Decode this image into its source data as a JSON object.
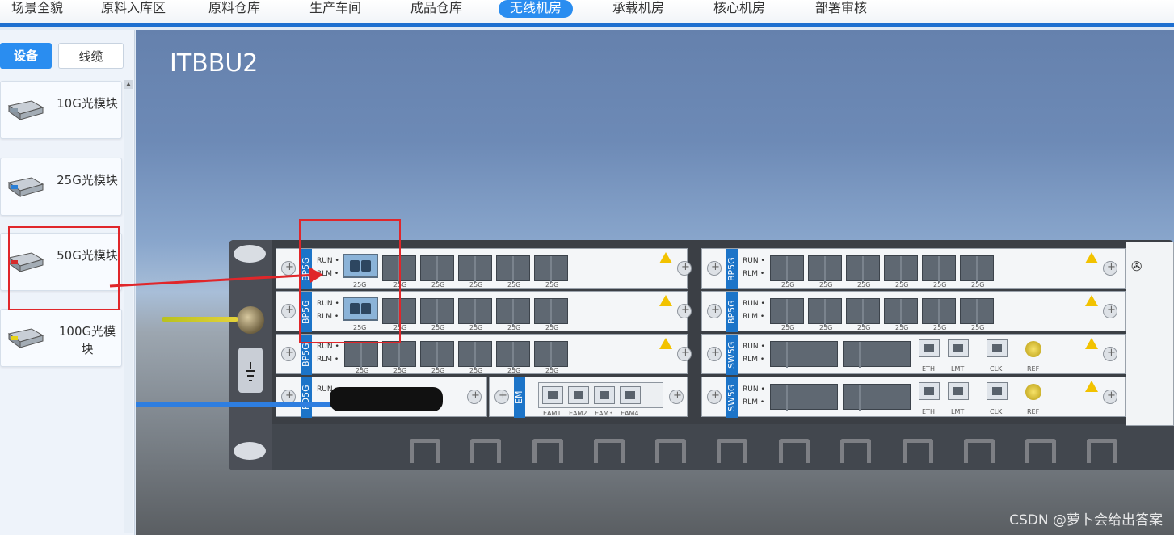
{
  "nav": {
    "tabs": [
      {
        "label": "场景全貌",
        "active": false
      },
      {
        "label": "原料入库区",
        "active": false
      },
      {
        "label": "原料仓库",
        "active": false
      },
      {
        "label": "生产车间",
        "active": false
      },
      {
        "label": "成品仓库",
        "active": false
      },
      {
        "label": "无线机房",
        "active": true
      },
      {
        "label": "承载机房",
        "active": false
      },
      {
        "label": "核心机房",
        "active": false
      },
      {
        "label": "部署审核",
        "active": false
      }
    ]
  },
  "sidebar": {
    "tabs": [
      {
        "label": "设备",
        "active": true
      },
      {
        "label": "线缆",
        "active": false
      }
    ],
    "items": [
      {
        "label": "10G光模块",
        "accent": "#8a9aa8"
      },
      {
        "label": "25G光模块",
        "accent": "#2a7fd6"
      },
      {
        "label": "50G光模块",
        "accent": "#d62a2a"
      },
      {
        "label": "100G光模块",
        "accent": "#e7d318"
      }
    ]
  },
  "scene": {
    "title": "ITBBU2",
    "boards": [
      {
        "name": "BP5G",
        "run": "RUN",
        "rlm": "RLM",
        "ports": [
          "25G",
          "25G",
          "25G",
          "25G",
          "25G",
          "25G"
        ]
      },
      {
        "name": "BP5G",
        "run": "RUN",
        "rlm": "RLM",
        "ports": [
          "25G",
          "25G",
          "25G",
          "25G",
          "25G",
          "25G"
        ]
      },
      {
        "name": "BP5G",
        "run": "RUN",
        "rlm": "RLM",
        "ports": [
          "25G",
          "25G",
          "25G",
          "25G",
          "25G",
          "25G"
        ]
      },
      {
        "name": "PD5G",
        "run": "RUN"
      },
      {
        "name": "EM",
        "ports": [
          "EAM1",
          "EAM2",
          "EAM3",
          "EAM4"
        ]
      },
      {
        "name": "BP5G",
        "run": "RUN",
        "rlm": "RLM",
        "ports": [
          "25G",
          "25G",
          "25G",
          "25G",
          "25G",
          "25G"
        ]
      },
      {
        "name": "BP5G",
        "run": "RUN",
        "rlm": "RLM",
        "ports": [
          "25G",
          "25G",
          "25G",
          "25G",
          "25G",
          "25G"
        ]
      },
      {
        "name": "SW5G",
        "run": "RUN",
        "rlm": "RLM",
        "rj45": [
          "ETH",
          "LMT",
          "CLK"
        ],
        "ref": "REF"
      },
      {
        "name": "SW5G",
        "run": "RUN",
        "rlm": "RLM",
        "rj45": [
          "ETH",
          "LMT",
          "CLK"
        ],
        "ref": "REF"
      }
    ]
  },
  "watermark": "CSDN @萝卜会给出答案",
  "colors": {
    "accent": "#2a8df0",
    "nav_border": "#1e6fd0",
    "highlight": "#e0262a"
  }
}
